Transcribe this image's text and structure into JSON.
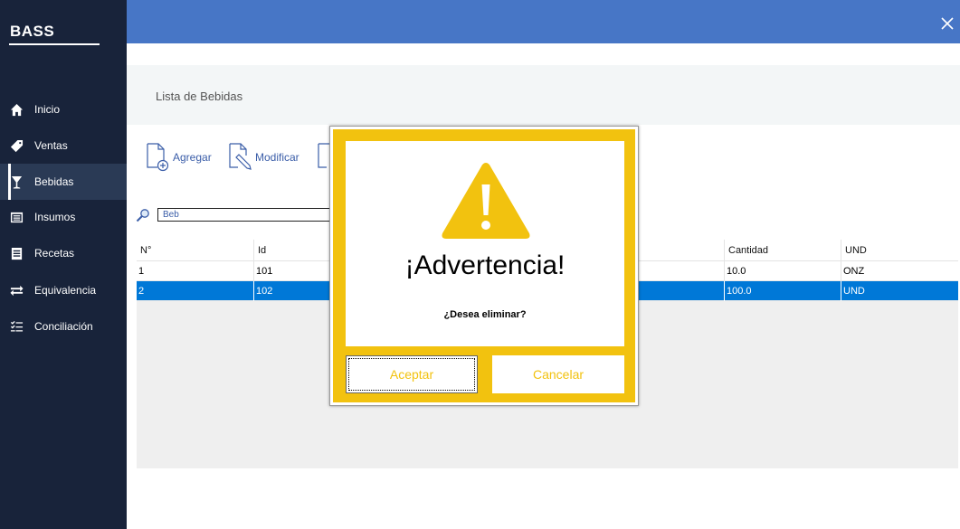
{
  "app": {
    "brand": "BASS"
  },
  "sidebar": {
    "items": [
      {
        "label": "Inicio",
        "icon": "home-icon"
      },
      {
        "label": "Ventas",
        "icon": "tag-icon"
      },
      {
        "label": "Bebidas",
        "icon": "glass-icon",
        "active": true
      },
      {
        "label": "Insumos",
        "icon": "list-icon"
      },
      {
        "label": "Recetas",
        "icon": "recipe-icon"
      },
      {
        "label": "Equivalencia",
        "icon": "swap-icon"
      },
      {
        "label": "Conciliación",
        "icon": "checklist-icon"
      }
    ]
  },
  "header": {
    "title": "Lista de Bebidas"
  },
  "toolbar": {
    "add_label": "Agregar",
    "edit_label": "Modificar"
  },
  "search": {
    "value": "Beb"
  },
  "table": {
    "columns": [
      "N°",
      "Id",
      "Cantidad",
      "UND"
    ],
    "rows": [
      {
        "n": "1",
        "id": "101",
        "cantidad": "10.0",
        "und": "ONZ"
      },
      {
        "n": "2",
        "id": "102",
        "cantidad": "100.0",
        "und": "UND",
        "selected": true
      }
    ]
  },
  "modal": {
    "title": "¡Advertencia!",
    "message": "¿Desea eliminar?",
    "accept_label": "Aceptar",
    "cancel_label": "Cancelar",
    "accent_color": "#f2c20f"
  },
  "colors": {
    "sidebar": "#18233a",
    "topbar": "#4776c6",
    "selection": "#0078d7"
  }
}
